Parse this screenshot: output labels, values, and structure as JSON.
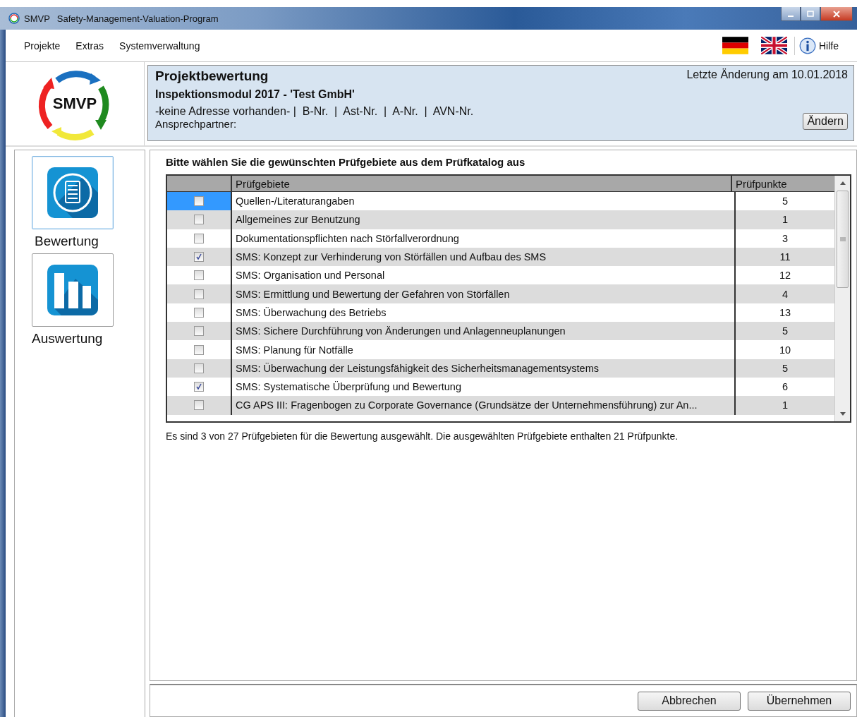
{
  "window": {
    "app_label": "SMVP",
    "title": "Safety-Management-Valuation-Program"
  },
  "menu": {
    "items": [
      "Projekte",
      "Extras",
      "Systemverwaltung"
    ],
    "help": "Hilfe"
  },
  "logo": {
    "text": "SMVP"
  },
  "header": {
    "title": "Projektbewertung",
    "last_change": "Letzte Änderung am 10.01.2018",
    "subtitle": "Inspektionsmodul 2017 - 'Test GmbH'",
    "address": "-keine Adresse vorhanden- |  B-Nr.  |  Ast-Nr.  |  A-Nr.  |  AVN-Nr.",
    "contact": "Ansprechpartner:",
    "button": "Ändern"
  },
  "sidebar": {
    "items": [
      {
        "label": "Bewertung",
        "selected": true
      },
      {
        "label": "Auswertung",
        "selected": false
      }
    ]
  },
  "content": {
    "heading": "Bitte wählen Sie die gewünschten Prüfgebiete aus dem Prüfkatalog aus",
    "table": {
      "columns": [
        "Prüfgebiete",
        "Prüfpunkte"
      ],
      "rows": [
        {
          "checked": false,
          "selected": true,
          "name": "Quellen-/Literaturangaben",
          "points": "5"
        },
        {
          "checked": false,
          "selected": false,
          "name": "Allgemeines zur Benutzung",
          "points": "1"
        },
        {
          "checked": false,
          "selected": false,
          "name": "Dokumentationspflichten nach Störfallverordnung",
          "points": "3"
        },
        {
          "checked": true,
          "selected": false,
          "name": "SMS: Konzept zur Verhinderung von Störfällen und Aufbau des SMS",
          "points": "11"
        },
        {
          "checked": false,
          "selected": false,
          "name": "SMS: Organisation und Personal",
          "points": "12"
        },
        {
          "checked": false,
          "selected": false,
          "name": "SMS: Ermittlung und Bewertung der Gefahren von Störfällen",
          "points": "4"
        },
        {
          "checked": false,
          "selected": false,
          "name": "SMS: Überwachung des Betriebs",
          "points": "13"
        },
        {
          "checked": false,
          "selected": false,
          "name": "SMS: Sichere Durchführung von Änderungen und Anlagenneuplanungen",
          "points": "5"
        },
        {
          "checked": false,
          "selected": false,
          "name": "SMS: Planung für Notfälle",
          "points": "10"
        },
        {
          "checked": false,
          "selected": false,
          "name": "SMS: Überwachung der Leistungsfähigkeit des Sicherheitsmanagementsystems",
          "points": "5"
        },
        {
          "checked": true,
          "selected": false,
          "name": "SMS: Systematische Überprüfung und Bewertung",
          "points": "6"
        },
        {
          "checked": false,
          "selected": false,
          "name": "CG APS III: Fragenbogen zu Corporate Governance (Grundsätze der Unternehmensführung) zur An...",
          "points": "1"
        }
      ]
    },
    "summary": "Es sind 3 von 27 Prüfgebieten für die Bewertung ausgewählt. Die ausgewählten Prüfgebiete enthalten 21 Prüfpunkte."
  },
  "buttons": [
    "Abbrechen",
    "Übernehmen"
  ]
}
